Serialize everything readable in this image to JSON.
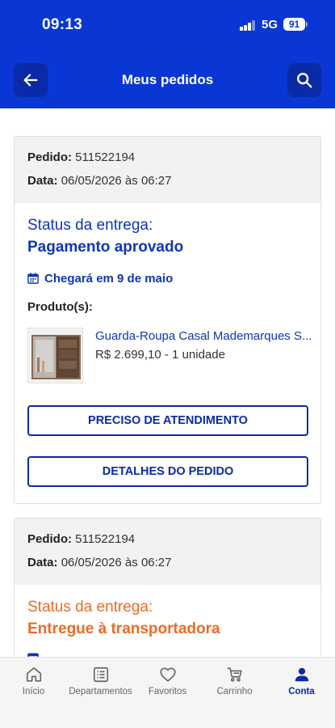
{
  "status_bar": {
    "time": "09:13",
    "network": "5G",
    "battery": "91"
  },
  "header": {
    "title": "Meus pedidos"
  },
  "orders": [
    {
      "order_label": "Pedido:",
      "order_number": "511522194",
      "date_label": "Data:",
      "date_value": "06/05/2026 às 06:27",
      "status_label": "Status da entrega:",
      "status_value": "Pagamento aprovado",
      "status_color": "#1035b8",
      "eta": "Chegará em 9 de maio",
      "products_label": "Produto(s):",
      "product": {
        "name": "Guarda-Roupa Casal Mademarques S...",
        "price_qty": "R$ 2.699,10 - 1 unidade"
      },
      "support_button": "PRECISO DE ATENDIMENTO",
      "details_button": "DETALHES DO PEDIDO"
    },
    {
      "order_label": "Pedido:",
      "order_number": "511522194",
      "date_label": "Data:",
      "date_value": "06/05/2026 às 06:27",
      "status_label": "Status da entrega:",
      "status_value": "Entregue à transportadora",
      "status_color": "#ee6b25"
    }
  ],
  "tabbar": {
    "items": [
      {
        "label": "Início",
        "icon": "home-icon"
      },
      {
        "label": "Departamentos",
        "icon": "list-icon"
      },
      {
        "label": "Favoritos",
        "icon": "heart-icon"
      },
      {
        "label": "Carrinho",
        "icon": "cart-icon"
      },
      {
        "label": "Conta",
        "icon": "user-icon",
        "active": true
      }
    ]
  }
}
